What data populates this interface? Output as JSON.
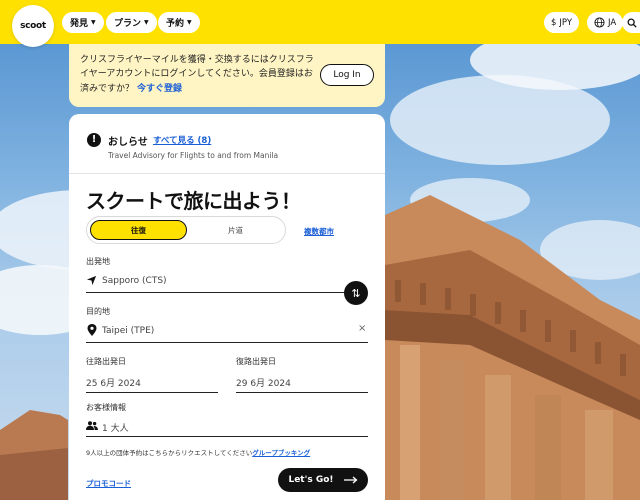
{
  "header": {
    "logo_text": "scoot",
    "nav": [
      {
        "label": "発見"
      },
      {
        "label": "プラン"
      },
      {
        "label": "予約"
      }
    ],
    "currency": "JPY",
    "language": "JA"
  },
  "login_banner": {
    "message": "クリスフライヤーマイルを獲得・交換するにはクリスフライヤーアカウントにログインしてください。会員登録はお済みですか？",
    "register_link": "今すぐ登録",
    "login_button": "Log In"
  },
  "notice": {
    "title": "おしらせ",
    "see_all": "すべて見る (8)",
    "subtitle": "Travel Advisory for Flights to and from Manila"
  },
  "booking": {
    "heading": "スクートで旅に出よう！",
    "trip_types": {
      "round_trip": "往復",
      "one_way": "片道"
    },
    "multi_city": "複数都市",
    "origin_label": "出発地",
    "origin_value": "Sapporo (CTS)",
    "destination_label": "目的地",
    "destination_value": "Taipei (TPE)",
    "depart_label": "往路出発日",
    "depart_value": "25 6月 2024",
    "return_label": "復路出発日",
    "return_value": "29 6月 2024",
    "passengers_label": "お客様情報",
    "passengers_value": "1 大人",
    "group_note": "9人以上の団体予約はこちらからリクエストしてください",
    "group_link": "グループブッキング",
    "promo_link": "プロモコード",
    "go_button": "Let's Go!"
  },
  "colors": {
    "brand_yellow": "#ffe100",
    "link_blue": "#1a5fd6",
    "banner_bg": "#fff5c4"
  }
}
